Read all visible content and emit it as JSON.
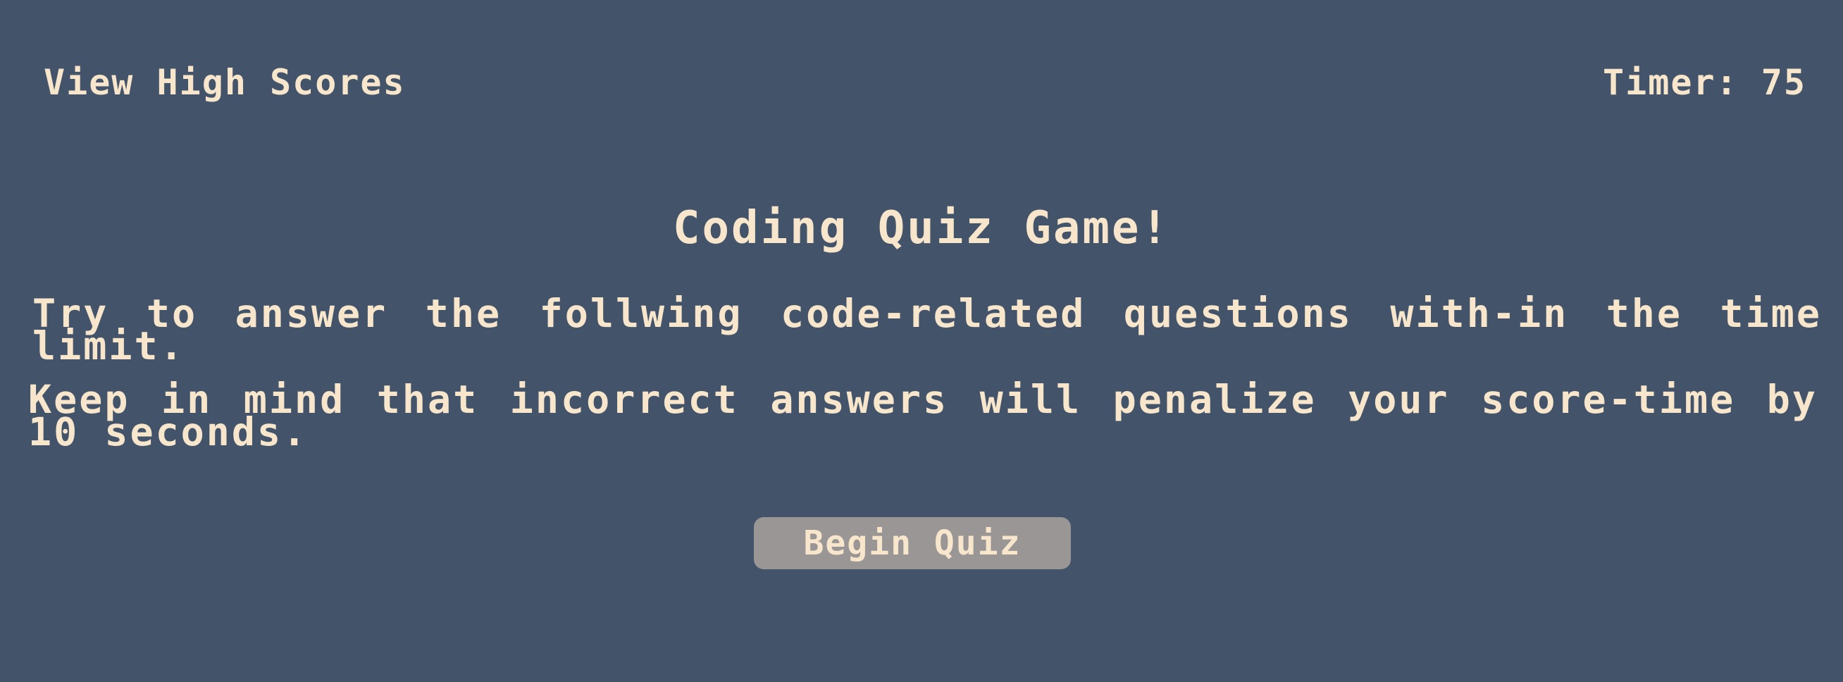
{
  "header": {
    "high_scores_label": "View High Scores",
    "timer_label": "Timer:",
    "timer_value": "75"
  },
  "main": {
    "title": "Coding Quiz Game!",
    "instructions": [
      "Try to answer the follwing code-related questions with-in the time limit.",
      "Keep in mind that incorrect answers will penalize your score-time by 10 seconds."
    ],
    "begin_button_label": "Begin Quiz"
  },
  "colors": {
    "background": "#435369",
    "text": "#f7e6cb",
    "button_bg": "#9a9696"
  }
}
